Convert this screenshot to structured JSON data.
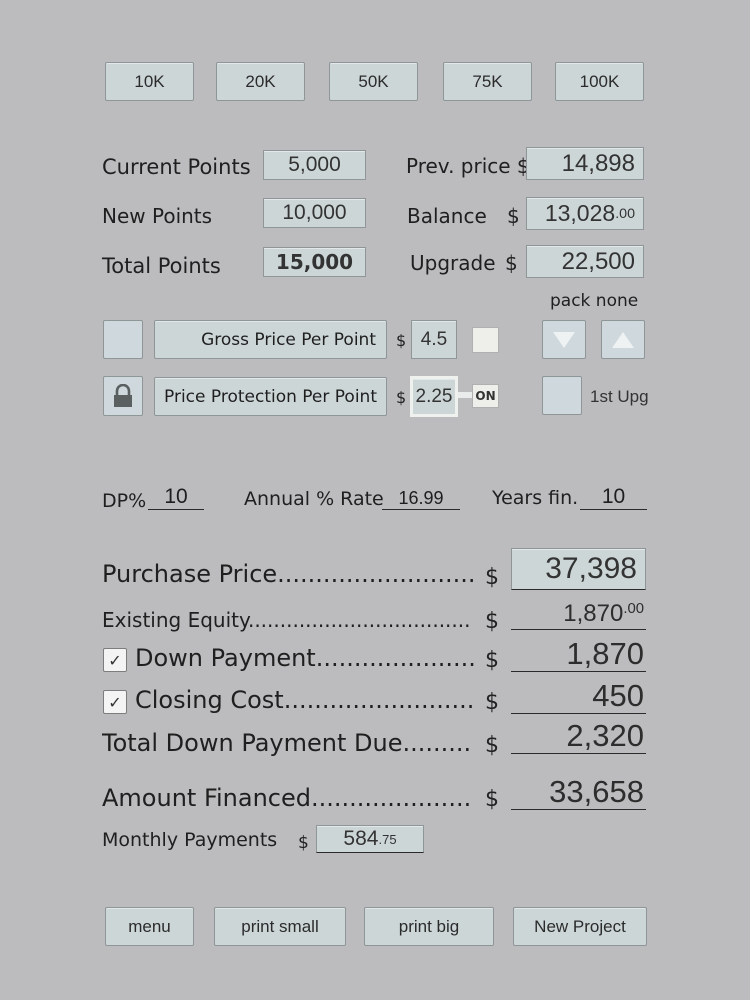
{
  "presets": [
    "10K",
    "20K",
    "50K",
    "75K",
    "100K"
  ],
  "points": {
    "current_label": "Current Points",
    "current_value": "5,000",
    "new_label": "New Points",
    "new_value": "10,000",
    "total_label": "Total Points",
    "total_value": "15,000"
  },
  "pricing": {
    "prev_label": "Prev. price $",
    "prev_value": "14,898",
    "balance_label": "Balance",
    "balance_currency": "$",
    "balance_main": "13,028",
    "balance_cents": ".00",
    "upgrade_label": "Upgrade",
    "upgrade_currency": "$",
    "upgrade_value": "22,500",
    "pack_label": "pack none"
  },
  "per_point": {
    "gross_label": "Gross Price Per Point",
    "gross_currency": "$",
    "gross_value": "4.5",
    "protection_label": "Price Protection Per Point",
    "protection_currency": "$",
    "protection_value": "2.25",
    "toggle_label": "ON",
    "first_upg_label": "1st Upg"
  },
  "financing": {
    "dp_label": "DP%",
    "dp_value": "10",
    "rate_label": "Annual % Rate",
    "rate_value": "16.99",
    "years_label": "Years fin.",
    "years_value": "10"
  },
  "summary": {
    "currency": "$",
    "purchase_label": "Purchase Price..........................",
    "purchase_value": "37,398",
    "equity_label": "Existing Equity...................................",
    "equity_main": "1,870",
    "equity_cents": ".00",
    "down_label": "Down Payment.....................",
    "down_value": "1,870",
    "down_checked": "✓",
    "closing_label": "Closing Cost.........................",
    "closing_value": "450",
    "closing_checked": "✓",
    "total_due_label": "Total Down Payment Due.........",
    "total_due_value": "2,320",
    "financed_label": "Amount Financed.....................",
    "financed_value": "33,658",
    "monthly_label": "Monthly Payments",
    "monthly_currency": "$",
    "monthly_main": "584",
    "monthly_cents": ".75"
  },
  "footer": [
    "menu",
    "print small",
    "print big",
    "New Project"
  ],
  "colors": {
    "background": "#bcbbbe",
    "button": "#cdd6d7",
    "border": "#8e9698"
  }
}
